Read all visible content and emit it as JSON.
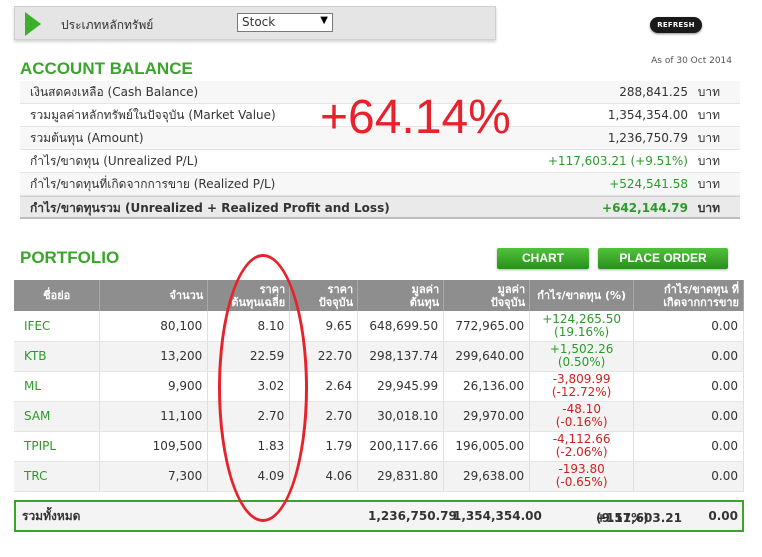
{
  "selector": {
    "label": "ประเภทหลักทรัพย์",
    "selected": "Stock"
  },
  "refresh_label": "REFRESH",
  "as_of": "As of 30 Oct 2014",
  "account": {
    "title": "ACCOUNT BALANCE",
    "rows": [
      {
        "label": "เงินสดคงเหลือ (Cash Balance)",
        "value": "288,841.25",
        "unit": "บาท"
      },
      {
        "label": "รวมมูลค่าหลักทรัพย์ในปัจจุบัน (Market Value)",
        "value": "1,354,354.00",
        "unit": "บาท"
      },
      {
        "label": "รวมต้นทุน (Amount)",
        "value": "1,236,750.79",
        "unit": "บาท"
      },
      {
        "label": "กำไร/ขาดทุน (Unrealized P/L)",
        "value": "+117,603.21 (+9.51%)",
        "unit": "บาท"
      },
      {
        "label": "กำไร/ขาดทุนที่เกิดจากการขาย (Realized P/L)",
        "value": "+524,541.58",
        "unit": "บาท"
      },
      {
        "label": "กำไร/ขาดทุนรวม (Unrealized + Realized Profit and Loss)",
        "value": "+642,144.79",
        "unit": "บาท"
      }
    ]
  },
  "annotation_pct": "+64.14%",
  "portfolio": {
    "title": "PORTFOLIO",
    "chart_button": "CHART",
    "order_button": "PLACE ORDER",
    "headers": {
      "symbol": "ชื่อย่อ",
      "qty": "จำนวน",
      "avg_cost_1": "ราคา",
      "avg_cost_2": "ต้นทุนเฉลี่ย",
      "price_1": "ราคา",
      "price_2": "ปัจจุบัน",
      "cost_1": "มูลค่า",
      "cost_2": "ต้นทุน",
      "mv_1": "มูลค่า",
      "mv_2": "ปัจจุบัน",
      "pl": "กำไร/ขาดทุน (%)",
      "rpl_1": "กำไร/ขาดทุน ที่",
      "rpl_2": "เกิดจากการขาย"
    },
    "rows": [
      {
        "symbol": "IFEC",
        "qty": "80,100",
        "avg": "8.10",
        "price": "9.65",
        "cost": "648,699.50",
        "mv": "772,965.00",
        "pl": "+124,265.50",
        "pct": "(19.16%)",
        "rpl": "0.00"
      },
      {
        "symbol": "KTB",
        "qty": "13,200",
        "avg": "22.59",
        "price": "22.70",
        "cost": "298,137.74",
        "mv": "299,640.00",
        "pl": "+1,502.26",
        "pct": "(0.50%)",
        "rpl": "0.00"
      },
      {
        "symbol": "ML",
        "qty": "9,900",
        "avg": "3.02",
        "price": "2.64",
        "cost": "29,945.99",
        "mv": "26,136.00",
        "pl": "-3,809.99",
        "pct": "(-12.72%)",
        "rpl": "0.00"
      },
      {
        "symbol": "SAM",
        "qty": "11,100",
        "avg": "2.70",
        "price": "2.70",
        "cost": "30,018.10",
        "mv": "29,970.00",
        "pl": "-48.10",
        "pct": "(-0.16%)",
        "rpl": "0.00"
      },
      {
        "symbol": "TPIPL",
        "qty": "109,500",
        "avg": "1.83",
        "price": "1.79",
        "cost": "200,117.66",
        "mv": "196,005.00",
        "pl": "-4,112.66",
        "pct": "(-2.06%)",
        "rpl": "0.00"
      },
      {
        "symbol": "TRC",
        "qty": "7,300",
        "avg": "4.09",
        "price": "4.06",
        "cost": "29,831.80",
        "mv": "29,638.00",
        "pl": "-193.80",
        "pct": "(-0.65%)",
        "rpl": "0.00"
      }
    ],
    "total": {
      "label": "รวมทั้งหมด",
      "cost": "1,236,750.79",
      "mv": "1,354,354.00",
      "pl": "+117,603.21",
      "pct": "(9.51%)",
      "rpl": "0.00"
    }
  },
  "colors": {
    "accent_green": "#3aa52b",
    "annotation_red": "#e8222b",
    "negative_red": "#d01f1f",
    "header_gray": "#8e8e8e"
  }
}
